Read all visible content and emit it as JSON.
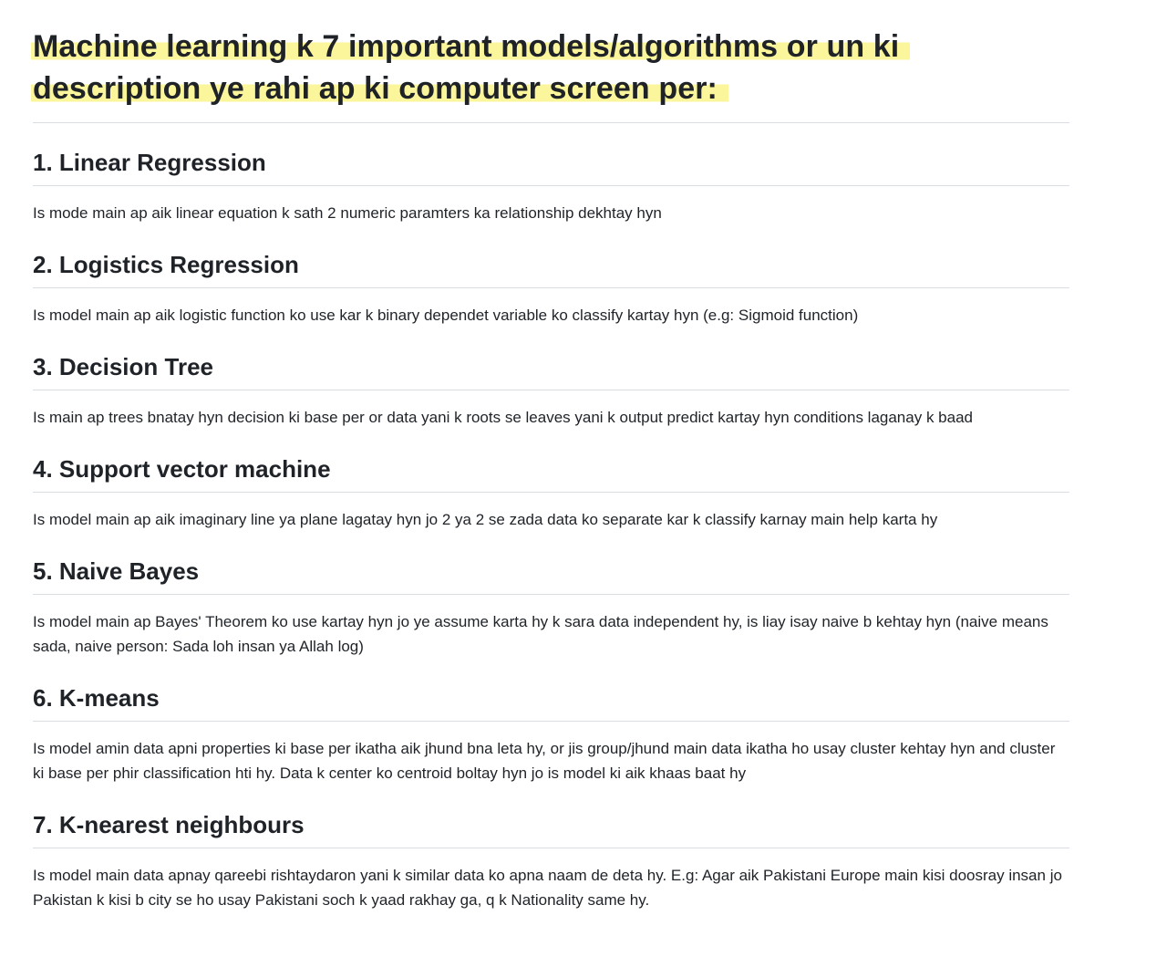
{
  "document": {
    "title": "Machine learning k 7 important models/algorithms or un ki description ye rahi ap ki computer screen per:",
    "sections": [
      {
        "heading": "1. Linear Regression",
        "body": "Is mode main ap aik linear equation k sath 2 numeric paramters ka relationship dekhtay hyn"
      },
      {
        "heading": "2. Logistics Regression",
        "body": "Is model main ap aik logistic function ko use kar k binary dependet variable ko classify kartay hyn (e.g: Sigmoid function)"
      },
      {
        "heading": "3. Decision Tree",
        "body": "Is main ap trees bnatay hyn decision ki base per or data yani k roots se leaves yani k output predict kartay hyn conditions laganay k baad"
      },
      {
        "heading": "4. Support vector machine",
        "body": "Is model main ap aik imaginary line ya plane lagatay hyn jo 2 ya 2 se zada data ko separate kar k classify karnay main help karta hy"
      },
      {
        "heading": "5. Naive Bayes",
        "body": "Is model main ap Bayes' Theorem ko use kartay hyn jo ye assume karta hy k sara data independent hy, is liay isay naive b kehtay hyn (naive means sada, naive person: Sada loh insan ya Allah log)"
      },
      {
        "heading": "6. K-means",
        "body": "Is model amin data apni properties ki base per ikatha aik jhund bna leta hy, or jis group/jhund main data ikatha ho usay cluster kehtay hyn and cluster ki base per phir classification hti hy. Data k center ko centroid boltay hyn jo is model ki aik khaas baat hy"
      },
      {
        "heading": "7. K-nearest neighbours",
        "body": "Is model main data apnay qareebi rishtaydaron yani k similar data ko apna naam de deta hy. E.g: Agar aik Pakistani Europe main kisi doosray insan jo Pakistan k kisi b city se ho usay Pakistani soch k yaad rakhay ga, q k Nationality same hy."
      }
    ]
  },
  "colors": {
    "highlight": "#fbf59b",
    "text": "#1f2328",
    "rule": "#d8dee4"
  }
}
